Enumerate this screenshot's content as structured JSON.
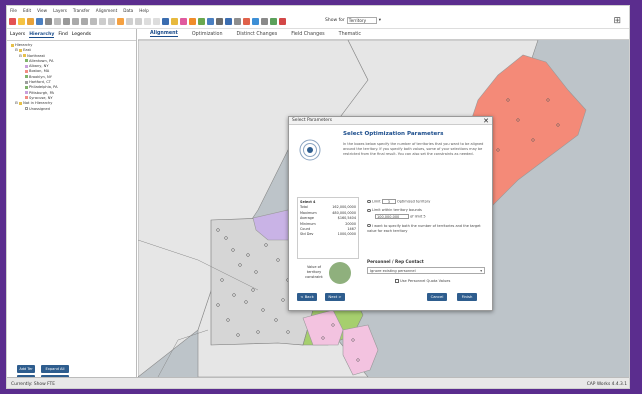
{
  "menu": [
    "File",
    "Edit",
    "View",
    "Layers",
    "Transfer",
    "Alignment",
    "Data",
    "Help"
  ],
  "toolbar": {
    "show_for_label": "Show for",
    "show_for_value": "Territory"
  },
  "left_tabs": [
    {
      "label": "Layers"
    },
    {
      "label": "Hierarchy",
      "active": true
    },
    {
      "label": "Find"
    },
    {
      "label": "Legends"
    }
  ],
  "tree": [
    {
      "label": "Hierarchy",
      "level": 0
    },
    {
      "label": "East",
      "level": 1
    },
    {
      "label": "Northeast",
      "level": 2
    },
    {
      "label": "Allentown, PA",
      "level": 3,
      "color": "#7fb36b"
    },
    {
      "label": "Albany, NY",
      "level": 3,
      "color": "#c9a0dc"
    },
    {
      "label": "Boston, MA",
      "level": 3,
      "color": "#f28b82"
    },
    {
      "label": "Brooklyn, NY",
      "level": 3,
      "color": "#7fb36b"
    },
    {
      "label": "Hartford, CT",
      "level": 3,
      "color": "#9e9e9e"
    },
    {
      "label": "Philadelphia, PA",
      "level": 3,
      "color": "#7fb36b"
    },
    {
      "label": "Pittsburgh, PA",
      "level": 3,
      "color": "#c9a0dc"
    },
    {
      "label": "Syracuse, NY",
      "level": 3,
      "color": "#f28b82"
    },
    {
      "label": "Not in Hierarchy",
      "level": 1
    },
    {
      "label": "Unassigned",
      "level": 2,
      "color": "#ffffff"
    }
  ],
  "left_buttons": {
    "add_ter": "Add Ter",
    "expand_all": "Expand All",
    "add_grp": "Add Grp",
    "collapse_all": "Collapse All"
  },
  "main_tabs": [
    {
      "label": "Alignment",
      "active": true
    },
    {
      "label": "Optimization"
    },
    {
      "label": "Distinct Changes"
    },
    {
      "label": "Field Changes"
    },
    {
      "label": "Thematic"
    }
  ],
  "status": {
    "left": "Currently: Show FTE",
    "right": "CAP Works 4.4.3.1"
  },
  "dialog": {
    "title": "Select Parameters",
    "heading": "Select Optimization Parameters",
    "description": "In the boxes below specify the number of territories that you want to be aligned around the territory. If you specify both values, some of your selections may be restricted from the final result. You can also set the constraints as needed.",
    "stats_title": "Select 4",
    "stats": [
      {
        "label": "Total",
        "value": "162,000,0000"
      },
      {
        "label": "Maximum",
        "value": "480,000,0000"
      },
      {
        "label": "Average",
        "value": "$160,5404"
      },
      {
        "label": "Minimum",
        "value": "20000"
      },
      {
        "label": "Count",
        "value": "1467"
      },
      {
        "label": "Std Dev",
        "value": "1000,0000"
      }
    ],
    "radio1_pre": "Limit",
    "radio1_value": "3",
    "radio1_post": "Optimized territory",
    "radio2": "Limit within territory bounds",
    "range_lo": "100,000,000",
    "range_hi": "10,000,0",
    "range_mid": "of limit 5",
    "radio3": "I want to specify both the number of territories and the target value for each territory",
    "value_flow": "Value of territory constraint",
    "dropdown_label": "Personnel / Rep Contact",
    "dropdown_value": "Ignore existing personnel",
    "use_checkbox": "Use Personnel Quota Values",
    "btn_back": "< Back",
    "btn_next": "Next >",
    "btn_cancel": "Cancel",
    "btn_finish": "Finish"
  },
  "colors": {
    "salmon": "#f48a78",
    "gray": "#d6d6d6",
    "green": "#a6cf6e",
    "pink": "#f3c3e0",
    "lavender": "#c9b3e6",
    "water": "#bdc4c9",
    "land": "#e6e6e6",
    "accent": "#1a4c8b"
  }
}
